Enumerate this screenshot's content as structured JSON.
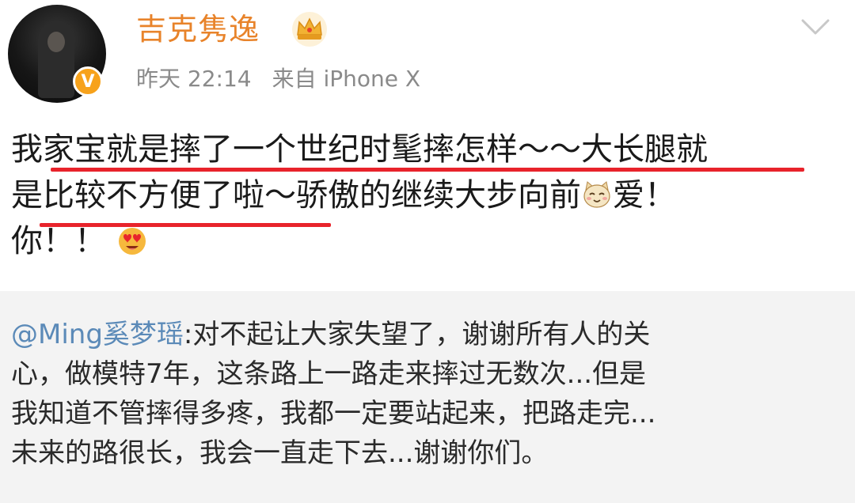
{
  "header": {
    "username": "吉克隽逸",
    "time": "昨天 22:14",
    "source": "来自 iPhone X"
  },
  "post": {
    "lines": [
      "我家宝就是摔了一个世纪时髦摔怎样～～大长腿就",
      "是比较不方便了啦～骄傲的继续大步向前",
      "爱！",
      "你！！"
    ]
  },
  "repost": {
    "mention": "@Ming奚梦瑶",
    "lines": [
      ":对不起让大家失望了，谢谢所有人的关",
      "心，做模特7年，这条路上一路走来摔过无数次...但是",
      "我知道不管摔得多疼，我都一定要站起来，把路走完...",
      "未来的路很长，我会一直走下去...谢谢你们。"
    ]
  },
  "icons": {
    "crown": "crown-icon",
    "verified": "verified-v-icon",
    "chevron": "chevron-down-icon",
    "cat_emoji": "cat-emoji-icon",
    "heart_eyes_emoji": "heart-eyes-emoji-icon"
  },
  "colors": {
    "username": "#e8832a",
    "mention": "#5b8ab8",
    "highlight_underline": "#e8232b",
    "repost_background": "#f3f3f3",
    "verified_badge": "#f7a21b"
  }
}
